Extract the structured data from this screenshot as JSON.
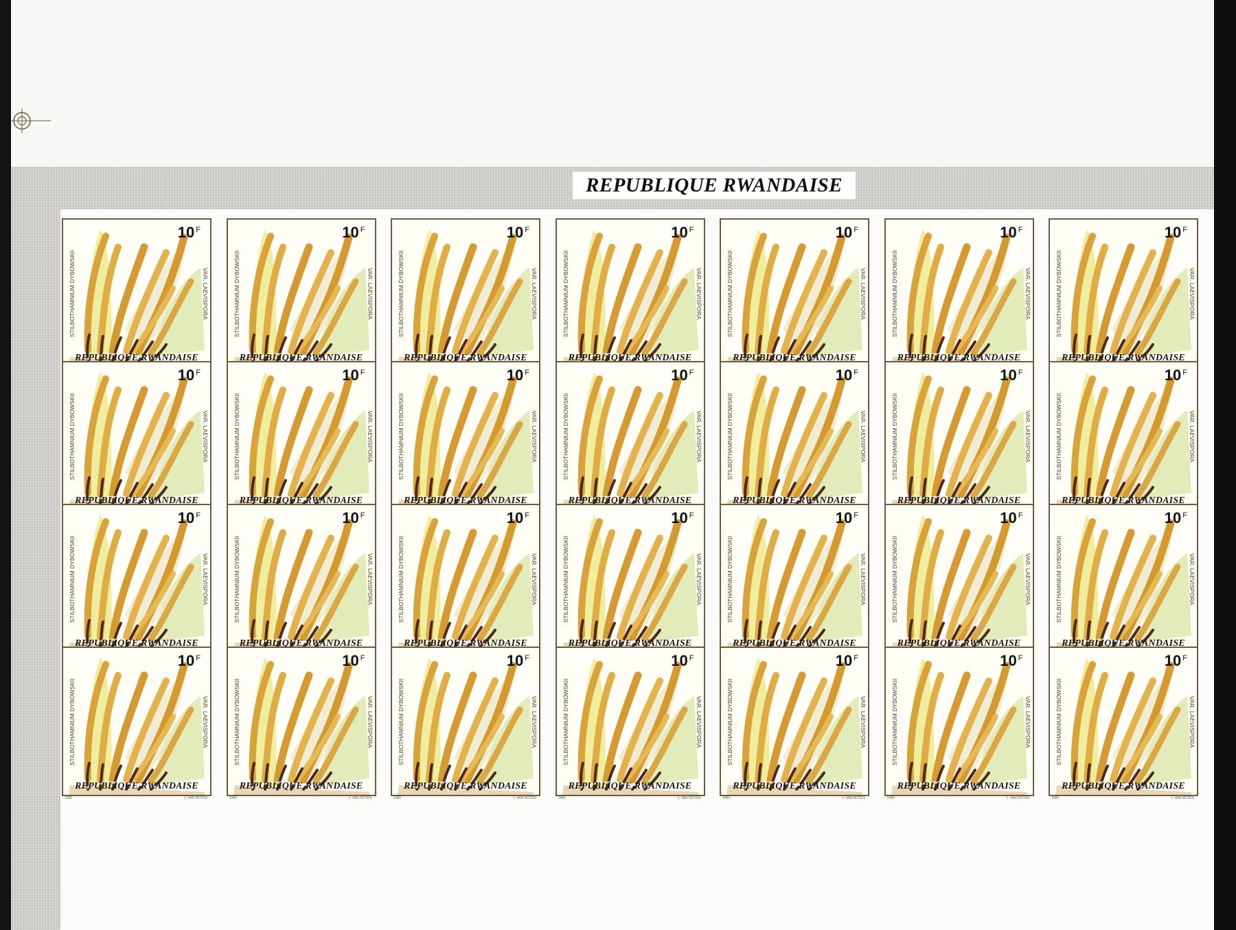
{
  "sheet": {
    "inscription": "REPUBLIQUE RWANDAISE",
    "rows": 4,
    "columns": 7
  },
  "stamp": {
    "value": "10",
    "currency": "F",
    "country": "REPUBLIQUE RWANDAISE",
    "species": "STILBOTHAMNIUM DYBOWSKII",
    "variety": "VAR. LAEVISPORA",
    "year": "1980",
    "designer": "J. VAN NOTEN"
  },
  "colors": {
    "paper": "#f4f4f2",
    "border": "#c9c7c3",
    "frame": "#6b5a3e",
    "fungus": "#d9a23a",
    "stalk_dark": "#4b2a1c",
    "background_green": "#d7e3a6",
    "background_yellow": "#f0ea9e"
  },
  "icons": {
    "registration": "registration-mark-icon"
  }
}
